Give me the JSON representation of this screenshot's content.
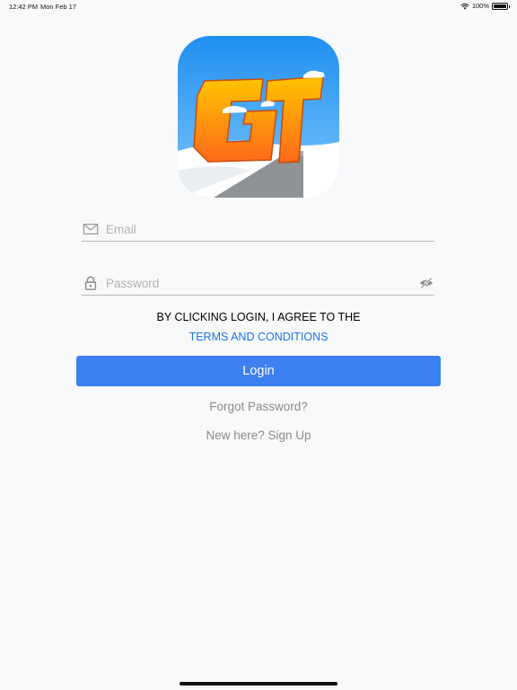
{
  "status_bar": {
    "time": "12:42 PM",
    "date": "Mon Feb 17",
    "battery_text": "100%",
    "battery_level_percent": 100,
    "icons": [
      "wifi-icon",
      "battery-icon"
    ]
  },
  "logo": {
    "letters": "GT",
    "colors": {
      "sky_top": "#1f8ff0",
      "sky_bottom": "#7fc6fb",
      "letters_top": "#ffc400",
      "letters_bottom": "#ff6a1a",
      "snow": "#ffffff",
      "road": "#8f9296"
    }
  },
  "form": {
    "email": {
      "placeholder": "Email",
      "value": "",
      "icon": "mail-icon"
    },
    "password": {
      "placeholder": "Password",
      "value": "",
      "icon": "lock-icon",
      "toggle_icon": "eye-slash-icon"
    }
  },
  "agreement": {
    "text": "BY CLICKING LOGIN, I AGREE TO THE",
    "link_text": "TERMS AND CONDITIONS"
  },
  "actions": {
    "login_label": "Login",
    "forgot_password": "Forgot Password?",
    "signup": "New here? Sign Up"
  },
  "colors": {
    "background": "#f8f9fb",
    "primary": "#3b7ff0",
    "link": "#1a73e8",
    "muted_text": "#8a8a8a"
  }
}
